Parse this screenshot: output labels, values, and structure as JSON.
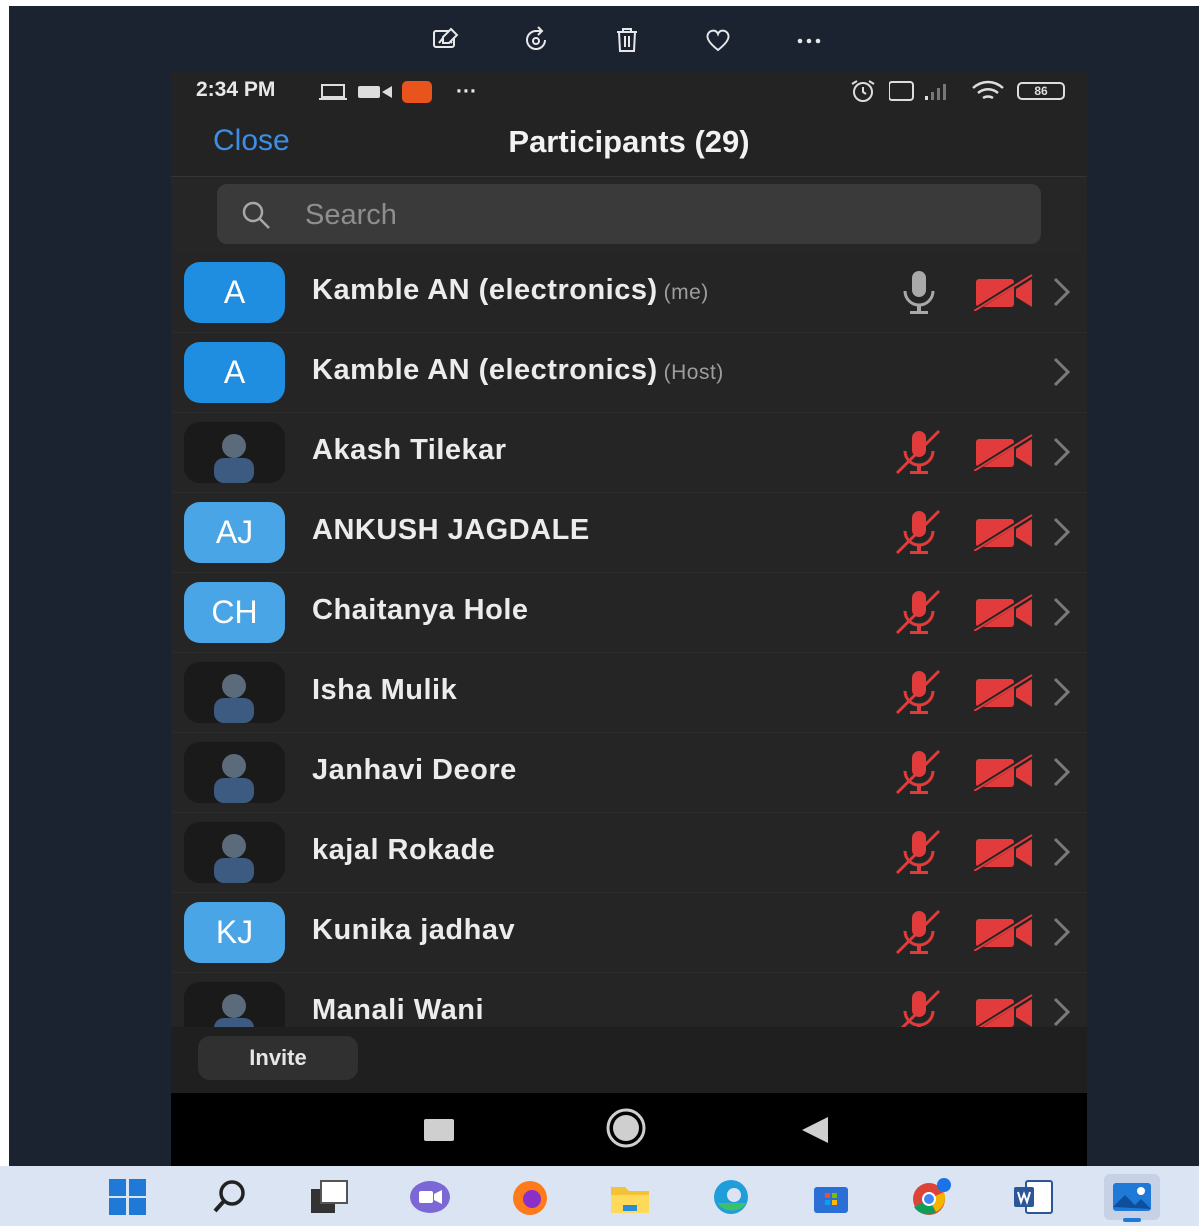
{
  "viewer": {
    "toolbar": [
      "edit-image",
      "rotate",
      "delete",
      "favorite",
      "more"
    ]
  },
  "phone": {
    "status": {
      "time": "2:34 PM",
      "dots": "···",
      "battery": "86"
    },
    "header": {
      "close_label": "Close",
      "title": "Participants (29)"
    },
    "search": {
      "placeholder": "Search"
    },
    "participants": [
      {
        "initials": "A",
        "name": "Kamble AN (electronics)",
        "tag": "(me)",
        "avatar": "blue",
        "mic": "on",
        "video": "off"
      },
      {
        "initials": "A",
        "name": "Kamble AN (electronics)",
        "tag": "(Host)",
        "avatar": "blue",
        "mic": "none",
        "video": "none"
      },
      {
        "initials": "",
        "name": "Akash Tilekar",
        "tag": "",
        "avatar": "photo",
        "mic": "muted",
        "video": "off"
      },
      {
        "initials": "AJ",
        "name": "ANKUSH JAGDALE",
        "tag": "",
        "avatar": "lightblue",
        "mic": "muted",
        "video": "off"
      },
      {
        "initials": "CH",
        "name": "Chaitanya Hole",
        "tag": "",
        "avatar": "lightblue",
        "mic": "muted",
        "video": "off"
      },
      {
        "initials": "",
        "name": "Isha Mulik",
        "tag": "",
        "avatar": "photo",
        "mic": "muted",
        "video": "off"
      },
      {
        "initials": "",
        "name": "Janhavi Deore",
        "tag": "",
        "avatar": "photo",
        "mic": "muted",
        "video": "off"
      },
      {
        "initials": "",
        "name": "kajal Rokade",
        "tag": "",
        "avatar": "photo",
        "mic": "muted",
        "video": "off"
      },
      {
        "initials": "KJ",
        "name": "Kunika jadhav",
        "tag": "",
        "avatar": "lightblue",
        "mic": "muted",
        "video": "off"
      },
      {
        "initials": "",
        "name": "Manali Wani",
        "tag": "",
        "avatar": "photo",
        "mic": "muted",
        "video": "off"
      }
    ],
    "invite_label": "Invite"
  },
  "taskbar": {
    "apps": [
      "start",
      "search",
      "task-view",
      "teams-chat",
      "firefox",
      "file-explorer",
      "edge",
      "microsoft-store",
      "chrome",
      "word",
      "photos"
    ],
    "active": "photos"
  },
  "colors": {
    "accent": "#3b8fe6",
    "muted_red": "#e23b3b",
    "avatar_blue": "#1f8ee0"
  }
}
